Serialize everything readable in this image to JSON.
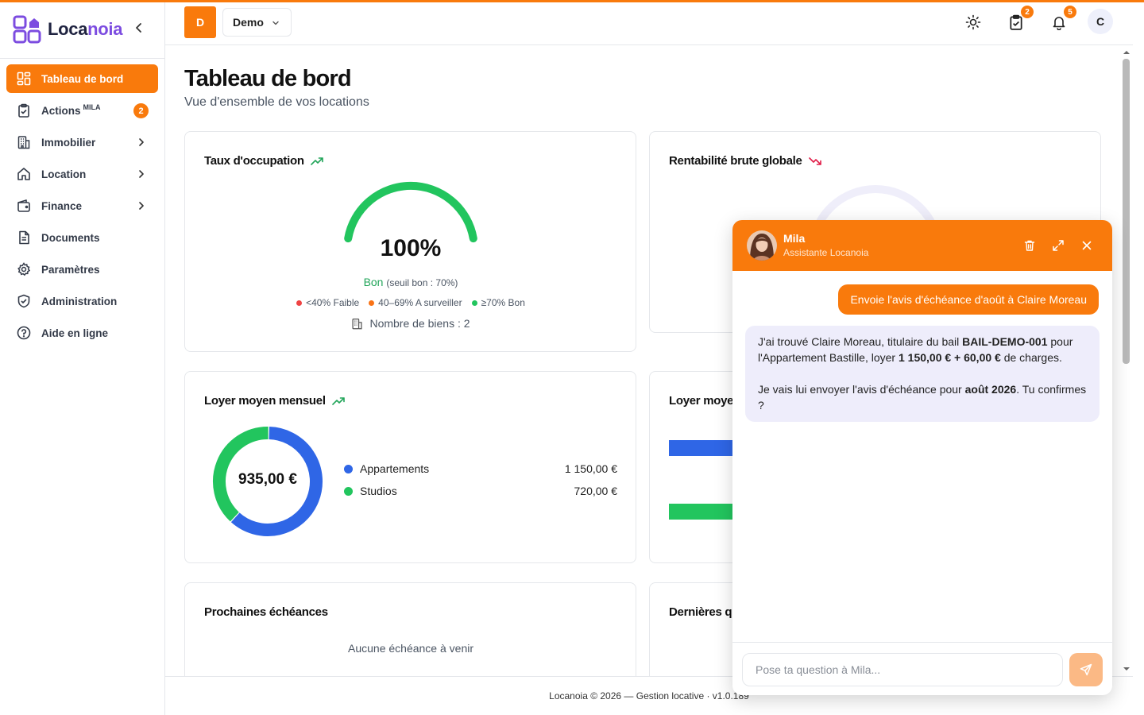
{
  "brand": {
    "name_part1": "Loca",
    "name_part2": "noia"
  },
  "colors": {
    "accent": "#f97a0c",
    "brand_purple": "#7c4ce0",
    "good": "#22c55e",
    "warn": "#f97316",
    "bad": "#ef4444",
    "blue": "#2f66e6"
  },
  "sidebar": {
    "items": [
      {
        "label": "Tableau de bord",
        "icon": "dashboard-icon",
        "active": true
      },
      {
        "label": "Actions",
        "sup": "MILA",
        "icon": "clipboard-check-icon",
        "badge": "2"
      },
      {
        "label": "Immobilier",
        "icon": "building-icon",
        "expandable": true
      },
      {
        "label": "Location",
        "icon": "home-icon",
        "expandable": true
      },
      {
        "label": "Finance",
        "icon": "wallet-icon",
        "expandable": true
      },
      {
        "label": "Documents",
        "icon": "document-icon"
      },
      {
        "label": "Paramètres",
        "icon": "gear-icon"
      },
      {
        "label": "Administration",
        "icon": "shield-check-icon"
      },
      {
        "label": "Aide en ligne",
        "icon": "help-circle-icon"
      }
    ]
  },
  "header": {
    "org_initial": "D",
    "org_name": "Demo",
    "tasks_badge": "2",
    "notifications_badge": "5",
    "user_initial": "C"
  },
  "page": {
    "title": "Tableau de bord",
    "subtitle": "Vue d'ensemble de vos locations"
  },
  "occupancy": {
    "title": "Taux d'occupation",
    "trend": "up",
    "value": "100%",
    "percent": 100,
    "status": "Bon",
    "threshold": "(seuil bon : 70%)",
    "legend": [
      "<40% Faible",
      "40–69% A surveiller",
      "≥70% Bon"
    ],
    "properties": "Nombre de biens : 2"
  },
  "profitability": {
    "title": "Rentabilité brute globale",
    "trend": "down"
  },
  "avg_rent": {
    "title": "Loyer moyen mensuel",
    "trend": "up",
    "center_value": "935,00 €",
    "chart_data": {
      "type": "pie",
      "categories": [
        "Appartements",
        "Studios"
      ],
      "values": [
        1150,
        720
      ],
      "value_labels": [
        "1 150,00 €",
        "720,00 €"
      ],
      "colors": [
        "#2f66e6",
        "#22c55e"
      ]
    }
  },
  "rent_by_type": {
    "title": "Loyer moye"
  },
  "upcoming": {
    "title": "Prochaines échéances",
    "empty": "Aucune échéance à venir"
  },
  "latest": {
    "title": "Dernières q"
  },
  "footer": {
    "text": "Locanoia © 2026 — Gestion locative · v1.0.189"
  },
  "chat": {
    "name": "Mila",
    "role": "Assistante Locanoia",
    "user_message": "Envoie l'avis d'échéance d'août à Claire Moreau",
    "bot": {
      "p1_a": "J'ai trouvé Claire Moreau, titulaire du bail ",
      "p1_b": "BAIL-DEMO-001",
      "p1_c": " pour l'Appartement Bastille, loyer ",
      "p1_d": "1 150,00 € + 60,00 €",
      "p1_e": " de charges.",
      "p2_a": "Je vais lui envoyer l'avis d'échéance pour ",
      "p2_b": "août 2026",
      "p2_c": ". Tu confirmes ?"
    },
    "placeholder": "Pose ta question à Mila..."
  }
}
